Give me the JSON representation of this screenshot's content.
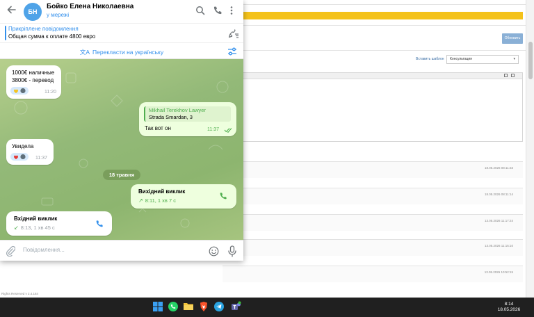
{
  "background_page": {
    "refresh_button": "Обновить",
    "insert_template": "Вставить шаблон",
    "template_select": "Консультация",
    "footer_text": "Rights Reserved v 2.4.184",
    "log_dates": [
      "18.05.2026 08:11:33",
      "18.05.2026 08:11:14",
      "13.05.2026 11:17:24",
      "13.05.2026 11:15:10",
      "13.05.2026 10:52:15"
    ]
  },
  "telegram": {
    "header": {
      "avatar_initials": "БН",
      "contact_name": "Бойко Елена Николаевна",
      "status": "у мережі"
    },
    "pinned": {
      "title": "Прикріплене повідомлення",
      "text": "Общая сумма к оплате 4800 евро"
    },
    "translate": {
      "label": "Перекласти на українську"
    },
    "messages": {
      "m1": {
        "line1": "1000€ наличные",
        "line2": "3800€ - перевод",
        "time": "11:20"
      },
      "m2": {
        "reply_author": "Mikhail Terekhov Lawyer",
        "reply_text": "Strada Smardan, 3",
        "text": "Так вот он",
        "time": "11:37"
      },
      "m3": {
        "text": "Увидела",
        "time": "11:37"
      },
      "date_separator": "18 травня",
      "m4": {
        "title": "Вихідний виклик",
        "info": "8:11, 1 хв 7 с"
      },
      "m5": {
        "title": "Вхідний виклик",
        "info": "8:13, 1 хв 45 с"
      }
    },
    "composer": {
      "placeholder": "Повідомлення..."
    }
  },
  "taskbar": {
    "time": "8:14",
    "date": "18.05.2026"
  },
  "colors": {
    "accent": "#3390ec",
    "outgoing_bubble": "#eeffde",
    "outgoing_accent": "#4fae4e",
    "chat_background": "#93b978",
    "taskbar": "#202020",
    "yellow_banner": "#f4c21a"
  }
}
